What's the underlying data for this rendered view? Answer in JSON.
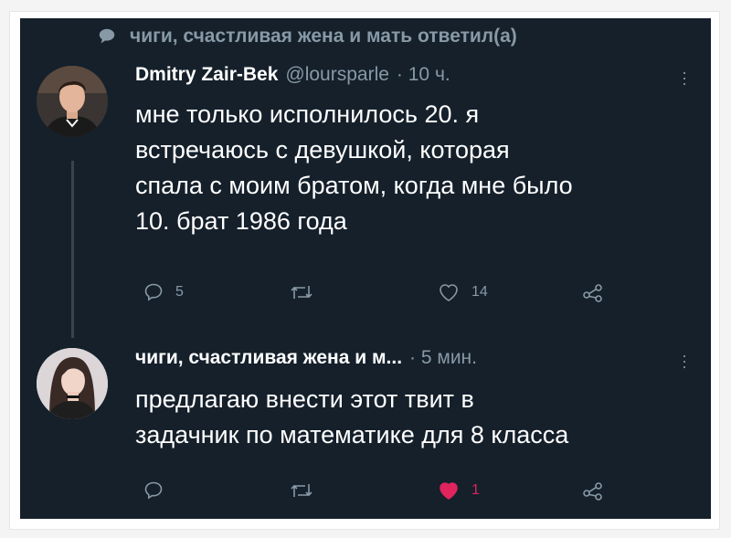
{
  "context": {
    "text": "чиги, счастливая жена и мать ответил(а)"
  },
  "tweet1": {
    "name": "Dmitry Zair-Bek",
    "handle": "@loursparle",
    "time": "· 10 ч.",
    "lines": [
      "мне только исполнилось 20. я",
      "встречаюсь с девушкой, которая",
      "спала с моим братом, когда мне было",
      "10. брат 1986 года"
    ],
    "reply_count": "5",
    "like_count": "14"
  },
  "tweet2": {
    "name": "чиги, счастливая жена и м...",
    "time": "· 5 мин.",
    "lines": [
      "предлагаю внести этот твит в",
      "задачник по математике для 8 класса"
    ],
    "like_count": "1"
  },
  "icons": {
    "reply": "reply-icon",
    "retweet": "retweet-icon",
    "like": "heart-icon",
    "share": "share-icon",
    "more": "more-vertical-icon"
  },
  "colors": {
    "background": "#15202b",
    "muted": "#8899a6",
    "liked": "#e0245e"
  }
}
